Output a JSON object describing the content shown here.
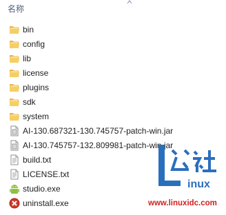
{
  "header": {
    "name_column": "名称"
  },
  "files": [
    {
      "name": "bin",
      "type": "folder",
      "icon": "folder-icon"
    },
    {
      "name": "config",
      "type": "folder",
      "icon": "folder-icon"
    },
    {
      "name": "lib",
      "type": "folder",
      "icon": "folder-icon"
    },
    {
      "name": "license",
      "type": "folder",
      "icon": "folder-icon"
    },
    {
      "name": "plugins",
      "type": "folder",
      "icon": "folder-icon"
    },
    {
      "name": "sdk",
      "type": "folder",
      "icon": "folder-icon"
    },
    {
      "name": "system",
      "type": "folder",
      "icon": "folder-icon"
    },
    {
      "name": "AI-130.687321-130.745757-patch-win.jar",
      "type": "jar",
      "icon": "jar-file-icon"
    },
    {
      "name": "AI-130.745757-132.809981-patch-win.jar",
      "type": "jar",
      "icon": "jar-file-icon"
    },
    {
      "name": "build.txt",
      "type": "text",
      "icon": "text-file-icon"
    },
    {
      "name": "LICENSE.txt",
      "type": "text",
      "icon": "text-file-icon"
    },
    {
      "name": "studio.exe",
      "type": "exe",
      "icon": "android-icon"
    },
    {
      "name": "uninstall.exe",
      "type": "exe",
      "icon": "uninstall-icon"
    }
  ],
  "watermark": {
    "logo_text": "公社",
    "logo_sub": "inux",
    "url": "www.linuxidc.com"
  }
}
